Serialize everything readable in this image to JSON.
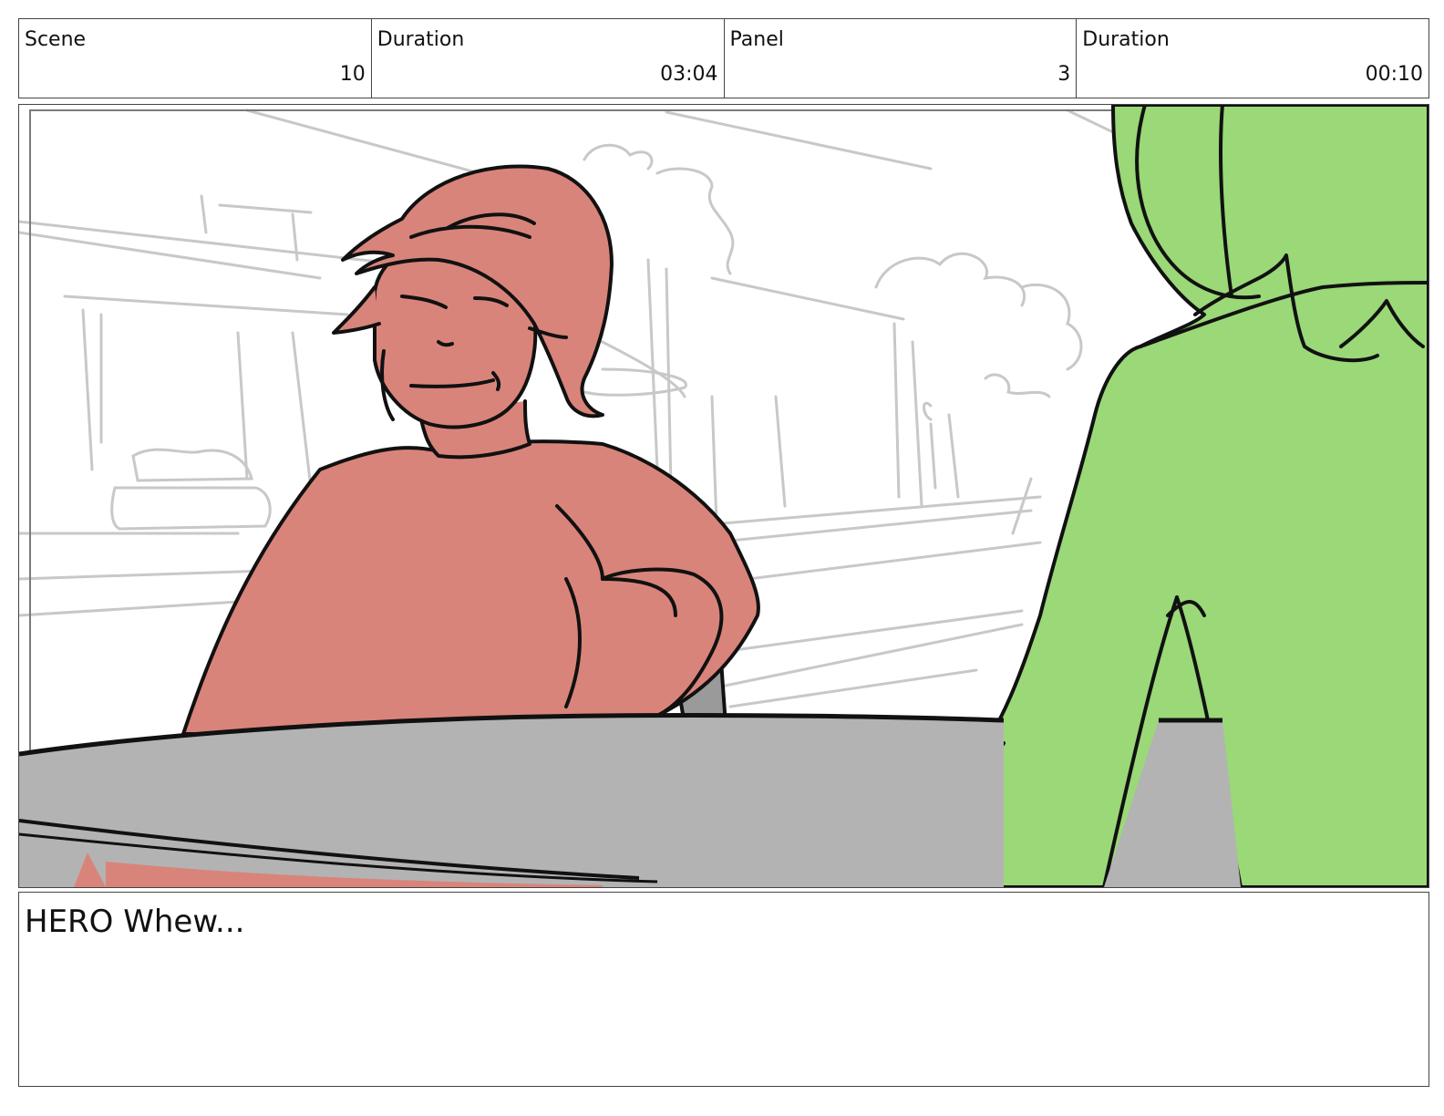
{
  "header": {
    "cells": [
      {
        "label": "Scene",
        "value": "10"
      },
      {
        "label": "Duration",
        "value": "03:04"
      },
      {
        "label": "Panel",
        "value": "3"
      },
      {
        "label": "Duration",
        "value": "00:10"
      }
    ]
  },
  "notes": {
    "dialogue": "HERO Whew..."
  },
  "colors": {
    "hero": "#d9847a",
    "companion": "#9ad878",
    "table": "#b3b3b3",
    "background_sketch": "#c8c8c8",
    "ink": "#111111"
  }
}
